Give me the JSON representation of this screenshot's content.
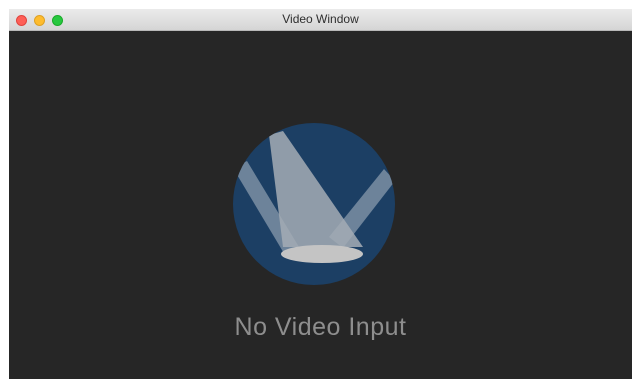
{
  "window": {
    "title": "Video Window"
  },
  "content": {
    "message": "No Video Input",
    "logo_icon": "spotlights-icon"
  },
  "colors": {
    "background": "#262626",
    "logo_circle": "#1c3f64",
    "message_text": "#8e8e8e"
  }
}
